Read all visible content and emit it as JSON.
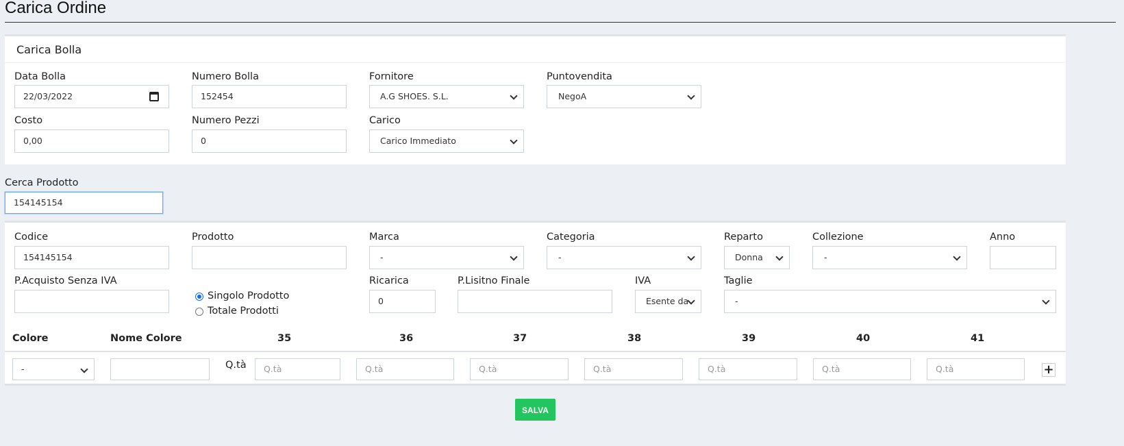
{
  "page": {
    "title": "Carica Ordine"
  },
  "bolla": {
    "header": "Carica Bolla",
    "data_label": "Data Bolla",
    "data_value": "22/03/2022",
    "numero_label": "Numero Bolla",
    "numero_value": "152454",
    "fornitore_label": "Fornitore",
    "fornitore_value": "A.G SHOES. S.L.",
    "puntovendita_label": "Puntovendita",
    "puntovendita_value": "NegoA",
    "costo_label": "Costo",
    "costo_value": "0,00",
    "pezzi_label": "Numero Pezzi",
    "pezzi_value": "0",
    "carico_label": "Carico",
    "carico_value": "Carico Immediato"
  },
  "search": {
    "label": "Cerca Prodotto",
    "value": "154145154"
  },
  "product": {
    "codice_label": "Codice",
    "codice_value": "154145154",
    "prodotto_label": "Prodotto",
    "prodotto_value": "",
    "marca_label": "Marca",
    "marca_value": "-",
    "categoria_label": "Categoria",
    "categoria_value": "-",
    "reparto_label": "Reparto",
    "reparto_value": "Donna",
    "collezione_label": "Collezione",
    "collezione_value": "-",
    "anno_label": "Anno",
    "anno_value": "",
    "acquisto_label": "P.Acquisto Senza IVA",
    "acquisto_value": "",
    "radio_singolo": "Singolo Prodotto",
    "radio_totale": "Totale Prodotti",
    "ricarica_label": "Ricarica",
    "ricarica_value": "0",
    "listino_label": "P.Lisitno Finale",
    "listino_value": "",
    "iva_label": "IVA",
    "iva_value": "Esente da",
    "taglie_label": "Taglie",
    "taglie_value": "-"
  },
  "sizes_table": {
    "colore_header": "Colore",
    "nome_colore_header": "Nome Colore",
    "sizes": [
      "35",
      "36",
      "37",
      "38",
      "39",
      "40",
      "41"
    ],
    "colore_value": "-",
    "qta_label": "Q.tà",
    "qta_placeholder": "Q.tà",
    "add_label": "+"
  },
  "actions": {
    "save_label": "SALVA"
  },
  "colors": {
    "save_button": "#22c55e",
    "focus_border": "#6ea8fe",
    "radio_checked": "#0d6efd",
    "page_bg": "#eceff3"
  }
}
